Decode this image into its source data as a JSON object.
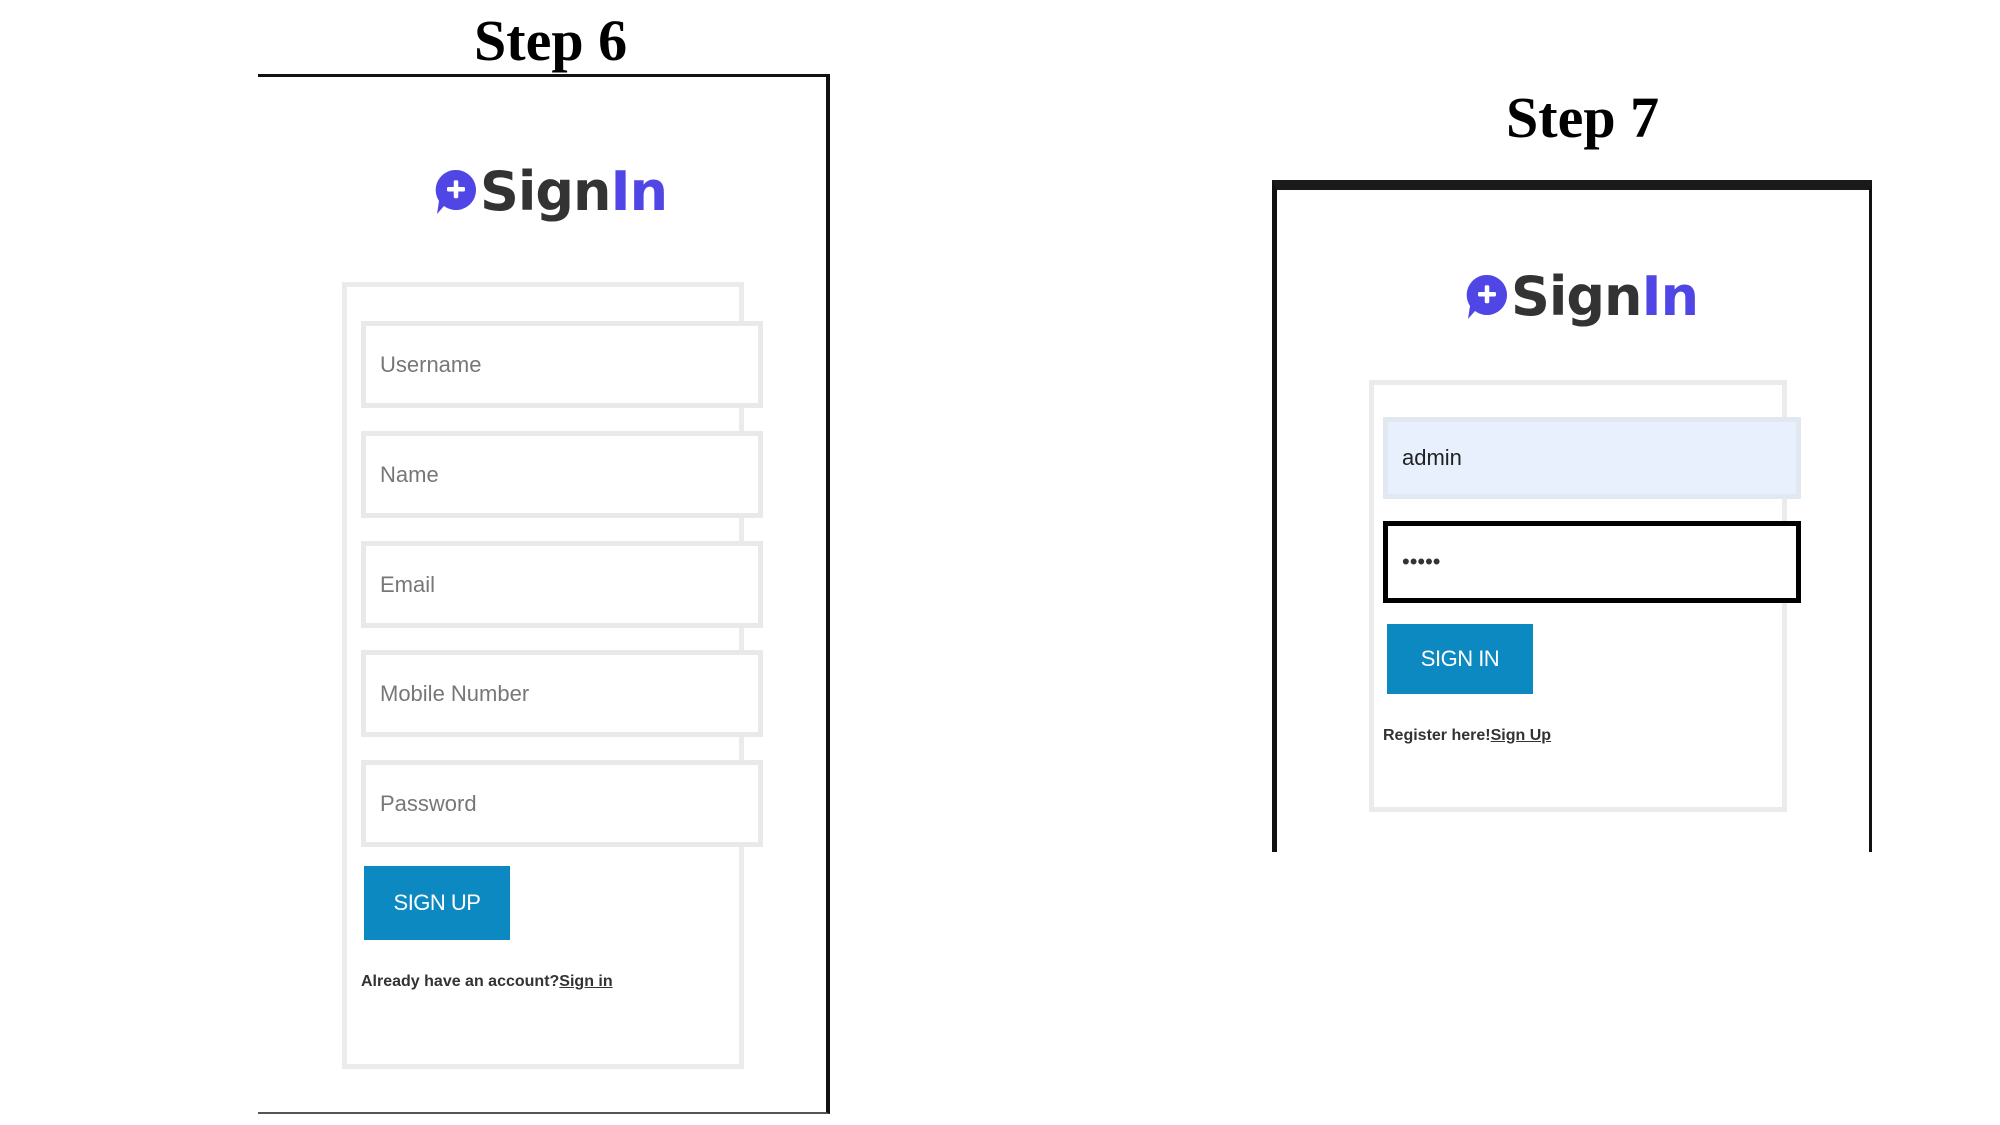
{
  "step6": {
    "title": "Step 6",
    "logo": {
      "text_sign": "Sign",
      "text_in": "In"
    },
    "form": {
      "username_placeholder": "Username",
      "name_placeholder": "Name",
      "email_placeholder": "Email",
      "mobile_placeholder": "Mobile Number",
      "password_placeholder": "Password",
      "submit_label": "SIGN UP"
    },
    "footer": {
      "prompt": "Already have an account?",
      "link": "Sign in"
    }
  },
  "step7": {
    "title": "Step 7",
    "logo": {
      "text_sign": "Sign",
      "text_in": "In"
    },
    "form": {
      "username_value": "admin",
      "password_value": "aaaaa",
      "submit_label": "SIGN IN"
    },
    "footer": {
      "prompt": "Register here!",
      "link": "Sign Up"
    }
  },
  "colors": {
    "brand_purple": "#4f46e5",
    "logo_text_dark": "#333333",
    "button_blue": "#0b89c0",
    "autofill_bg": "#e8f0fe",
    "card_border": "#ebebeb"
  },
  "icons": {
    "logo": "chat-bubble-plus-icon"
  }
}
